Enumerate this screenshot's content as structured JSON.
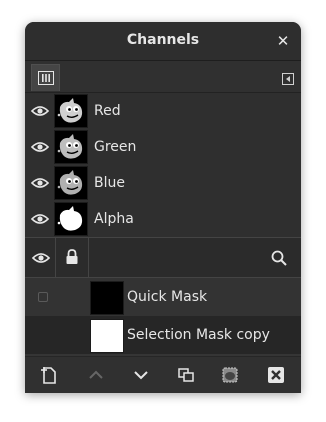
{
  "window": {
    "title": "Channels",
    "close_glyph": "✕"
  },
  "tab": {
    "icon": "channels-tab-icon"
  },
  "channels": [
    {
      "name": "Red",
      "visible": true
    },
    {
      "name": "Green",
      "visible": true
    },
    {
      "name": "Blue",
      "visible": true
    },
    {
      "name": "Alpha",
      "visible": true
    }
  ],
  "columns": {
    "visibility": "eye-icon",
    "lock": "lock-icon",
    "search": "search-icon"
  },
  "masks": [
    {
      "name": "Quick Mask",
      "thumb_color": "#000000",
      "checked": false
    },
    {
      "name": "Selection Mask copy",
      "thumb_color": "#ffffff",
      "selected": true
    }
  ],
  "toolbar": {
    "buttons": [
      "new-channel",
      "raise-channel",
      "lower-channel",
      "duplicate-channel",
      "channel-to-selection",
      "delete-channel"
    ]
  },
  "colors": {
    "panel": "#353535",
    "text": "#e6e6e6",
    "selected_row": "#262626"
  }
}
